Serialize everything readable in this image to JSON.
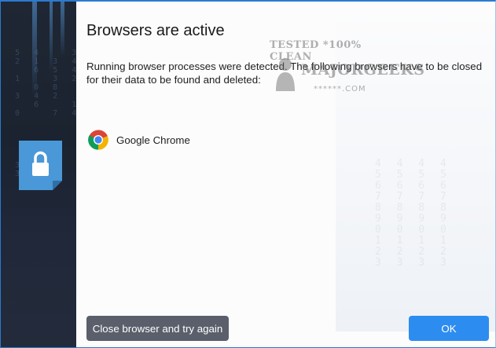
{
  "dialog": {
    "title": "Browsers are active",
    "message": "Running browser processes were detected. The following browsers have to be closed for their data to be found and deleted:"
  },
  "browsers": [
    {
      "name": "Google Chrome",
      "icon": "chrome-icon"
    }
  ],
  "watermark": {
    "line1": "TESTED *100% CLEAN",
    "line2": "MAJORGEEKS",
    "line3": "******.COM"
  },
  "buttons": {
    "close_try_again": "Close browser and try again",
    "ok": "OK"
  },
  "sidebar": {
    "icon": "lock-icon"
  },
  "colors": {
    "accent": "#2d8cf0",
    "secondary_button": "#5a5f6b",
    "sidebar": "#1f2734",
    "lock_badge": "#4a98d8"
  }
}
